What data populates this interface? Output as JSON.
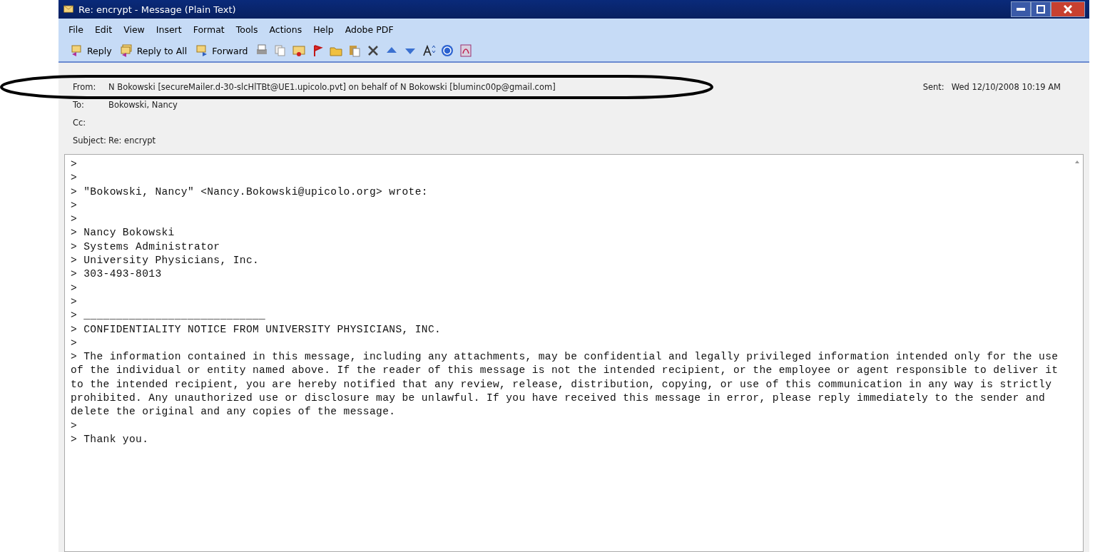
{
  "window": {
    "title": "Re: encrypt - Message (Plain Text)"
  },
  "menu": [
    "File",
    "Edit",
    "View",
    "Insert",
    "Format",
    "Tools",
    "Actions",
    "Help",
    "Adobe PDF"
  ],
  "toolbar": [
    {
      "kind": "labeled",
      "label": "Reply"
    },
    {
      "kind": "labeled",
      "label": "Reply to All"
    },
    {
      "kind": "labeled",
      "label": "Forward"
    },
    {
      "kind": "icon"
    },
    {
      "kind": "icon"
    },
    {
      "kind": "icon"
    },
    {
      "kind": "icon"
    },
    {
      "kind": "icon"
    },
    {
      "kind": "icon"
    },
    {
      "kind": "icon"
    },
    {
      "kind": "icon"
    },
    {
      "kind": "icon"
    },
    {
      "kind": "icon"
    },
    {
      "kind": "icon"
    },
    {
      "kind": "icon"
    }
  ],
  "header": {
    "fields": [
      {
        "label": "From:",
        "value": "N Bokowski [secureMailer.d-30-slcHlTBt@UE1.upicolo.pvt] on behalf of N Bokowski [bluminc00p@gmail.com]"
      },
      {
        "label": "To:",
        "value": "Bokowski, Nancy"
      },
      {
        "label": "Cc:"
      },
      {
        "label": "Subject:",
        "value": "Re: encrypt"
      }
    ],
    "sent": {
      "label": "Sent:",
      "value": "Wed 12/10/2008 10:19 AM"
    }
  },
  "body": {
    "lines": [
      ">",
      ">",
      "> \"Bokowski, Nancy\" <Nancy.Bokowski@upicolo.org> wrote:",
      ">",
      ">",
      "> Nancy Bokowski",
      "> Systems Administrator",
      "> University Physicians, Inc.",
      "> 303-493-8013",
      ">",
      ">",
      "> ____________________________",
      "> CONFIDENTIALITY NOTICE FROM UNIVERSITY PHYSICIANS, INC.",
      ">",
      "> The information contained in this message, including any attachments, may be confidential and legally privileged information intended only for the use",
      "of the individual or entity named above. If the reader of this message is not the intended recipient, or the employee or agent responsible to deliver it",
      "to the intended recipient, you are hereby notified that any review, release, distribution, copying, or use of this communication in any way is strictly",
      "prohibited. Any unauthorized use or disclosure may be unlawful. If you have received this message in error, please reply immediately to the sender and",
      "delete the original and any copies of the message.",
      ">",
      "> Thank you."
    ]
  }
}
